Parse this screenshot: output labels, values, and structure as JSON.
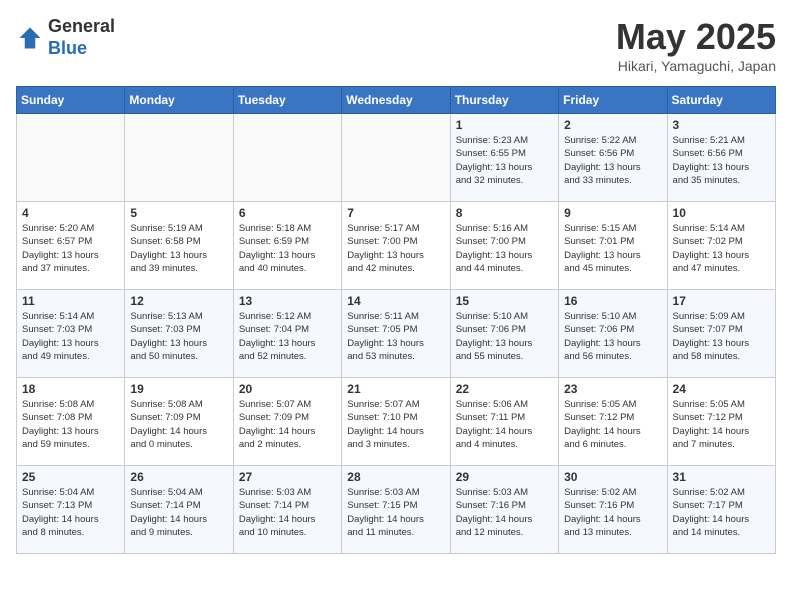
{
  "logo": {
    "general": "General",
    "blue": "Blue"
  },
  "title": "May 2025",
  "location": "Hikari, Yamaguchi, Japan",
  "days_of_week": [
    "Sunday",
    "Monday",
    "Tuesday",
    "Wednesday",
    "Thursday",
    "Friday",
    "Saturday"
  ],
  "weeks": [
    [
      {
        "day": "",
        "info": ""
      },
      {
        "day": "",
        "info": ""
      },
      {
        "day": "",
        "info": ""
      },
      {
        "day": "",
        "info": ""
      },
      {
        "day": "1",
        "info": "Sunrise: 5:23 AM\nSunset: 6:55 PM\nDaylight: 13 hours\nand 32 minutes."
      },
      {
        "day": "2",
        "info": "Sunrise: 5:22 AM\nSunset: 6:56 PM\nDaylight: 13 hours\nand 33 minutes."
      },
      {
        "day": "3",
        "info": "Sunrise: 5:21 AM\nSunset: 6:56 PM\nDaylight: 13 hours\nand 35 minutes."
      }
    ],
    [
      {
        "day": "4",
        "info": "Sunrise: 5:20 AM\nSunset: 6:57 PM\nDaylight: 13 hours\nand 37 minutes."
      },
      {
        "day": "5",
        "info": "Sunrise: 5:19 AM\nSunset: 6:58 PM\nDaylight: 13 hours\nand 39 minutes."
      },
      {
        "day": "6",
        "info": "Sunrise: 5:18 AM\nSunset: 6:59 PM\nDaylight: 13 hours\nand 40 minutes."
      },
      {
        "day": "7",
        "info": "Sunrise: 5:17 AM\nSunset: 7:00 PM\nDaylight: 13 hours\nand 42 minutes."
      },
      {
        "day": "8",
        "info": "Sunrise: 5:16 AM\nSunset: 7:00 PM\nDaylight: 13 hours\nand 44 minutes."
      },
      {
        "day": "9",
        "info": "Sunrise: 5:15 AM\nSunset: 7:01 PM\nDaylight: 13 hours\nand 45 minutes."
      },
      {
        "day": "10",
        "info": "Sunrise: 5:14 AM\nSunset: 7:02 PM\nDaylight: 13 hours\nand 47 minutes."
      }
    ],
    [
      {
        "day": "11",
        "info": "Sunrise: 5:14 AM\nSunset: 7:03 PM\nDaylight: 13 hours\nand 49 minutes."
      },
      {
        "day": "12",
        "info": "Sunrise: 5:13 AM\nSunset: 7:03 PM\nDaylight: 13 hours\nand 50 minutes."
      },
      {
        "day": "13",
        "info": "Sunrise: 5:12 AM\nSunset: 7:04 PM\nDaylight: 13 hours\nand 52 minutes."
      },
      {
        "day": "14",
        "info": "Sunrise: 5:11 AM\nSunset: 7:05 PM\nDaylight: 13 hours\nand 53 minutes."
      },
      {
        "day": "15",
        "info": "Sunrise: 5:10 AM\nSunset: 7:06 PM\nDaylight: 13 hours\nand 55 minutes."
      },
      {
        "day": "16",
        "info": "Sunrise: 5:10 AM\nSunset: 7:06 PM\nDaylight: 13 hours\nand 56 minutes."
      },
      {
        "day": "17",
        "info": "Sunrise: 5:09 AM\nSunset: 7:07 PM\nDaylight: 13 hours\nand 58 minutes."
      }
    ],
    [
      {
        "day": "18",
        "info": "Sunrise: 5:08 AM\nSunset: 7:08 PM\nDaylight: 13 hours\nand 59 minutes."
      },
      {
        "day": "19",
        "info": "Sunrise: 5:08 AM\nSunset: 7:09 PM\nDaylight: 14 hours\nand 0 minutes."
      },
      {
        "day": "20",
        "info": "Sunrise: 5:07 AM\nSunset: 7:09 PM\nDaylight: 14 hours\nand 2 minutes."
      },
      {
        "day": "21",
        "info": "Sunrise: 5:07 AM\nSunset: 7:10 PM\nDaylight: 14 hours\nand 3 minutes."
      },
      {
        "day": "22",
        "info": "Sunrise: 5:06 AM\nSunset: 7:11 PM\nDaylight: 14 hours\nand 4 minutes."
      },
      {
        "day": "23",
        "info": "Sunrise: 5:05 AM\nSunset: 7:12 PM\nDaylight: 14 hours\nand 6 minutes."
      },
      {
        "day": "24",
        "info": "Sunrise: 5:05 AM\nSunset: 7:12 PM\nDaylight: 14 hours\nand 7 minutes."
      }
    ],
    [
      {
        "day": "25",
        "info": "Sunrise: 5:04 AM\nSunset: 7:13 PM\nDaylight: 14 hours\nand 8 minutes."
      },
      {
        "day": "26",
        "info": "Sunrise: 5:04 AM\nSunset: 7:14 PM\nDaylight: 14 hours\nand 9 minutes."
      },
      {
        "day": "27",
        "info": "Sunrise: 5:03 AM\nSunset: 7:14 PM\nDaylight: 14 hours\nand 10 minutes."
      },
      {
        "day": "28",
        "info": "Sunrise: 5:03 AM\nSunset: 7:15 PM\nDaylight: 14 hours\nand 11 minutes."
      },
      {
        "day": "29",
        "info": "Sunrise: 5:03 AM\nSunset: 7:16 PM\nDaylight: 14 hours\nand 12 minutes."
      },
      {
        "day": "30",
        "info": "Sunrise: 5:02 AM\nSunset: 7:16 PM\nDaylight: 14 hours\nand 13 minutes."
      },
      {
        "day": "31",
        "info": "Sunrise: 5:02 AM\nSunset: 7:17 PM\nDaylight: 14 hours\nand 14 minutes."
      }
    ]
  ]
}
